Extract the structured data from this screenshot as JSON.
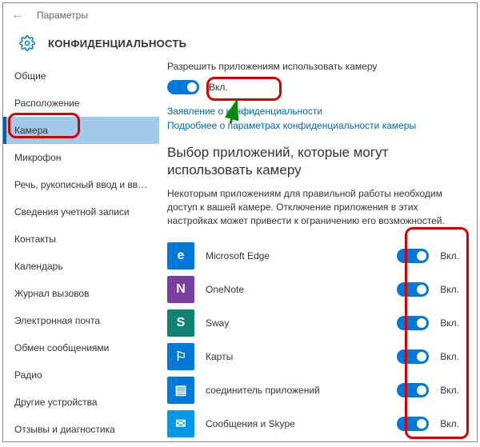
{
  "titlebar": {
    "label": "Параметры"
  },
  "header": {
    "title": "КОНФИДЕНЦИАЛЬНОСТЬ"
  },
  "sidebar": {
    "items": [
      {
        "label": "Общие"
      },
      {
        "label": "Расположение"
      },
      {
        "label": "Камера"
      },
      {
        "label": "Микрофон"
      },
      {
        "label": "Речь, рукописный ввод и ввод текста"
      },
      {
        "label": "Сведения учетной записи"
      },
      {
        "label": "Контакты"
      },
      {
        "label": "Календарь"
      },
      {
        "label": "Журнал вызовов"
      },
      {
        "label": "Электронная почта"
      },
      {
        "label": "Обмен сообщениями"
      },
      {
        "label": "Радио"
      },
      {
        "label": "Другие устройства"
      },
      {
        "label": "Отзывы и диагностика"
      }
    ]
  },
  "content": {
    "permission_title": "Разрешить приложениям использовать камеру",
    "master_toggle_label": "Вкл.",
    "link1": "Заявление о конфиденциальности",
    "link2": "Подробнее о параметрах конфиденциальности камеры",
    "subheading": "Выбор приложений, которые могут использовать камеру",
    "desc": "Некоторым приложениям для правильной работы необходим доступ к вашей камере. Отключение приложения в этих настройках может привести к ограничению его возможностей.",
    "apps": [
      {
        "name": "Microsoft Edge",
        "icon": "e",
        "color": "#0078d7",
        "state": "Вкл."
      },
      {
        "name": "OneNote",
        "icon": "N",
        "color": "#7b3fa0",
        "state": "Вкл."
      },
      {
        "name": "Sway",
        "icon": "S",
        "color": "#108272",
        "state": "Вкл."
      },
      {
        "name": "Карты",
        "icon": "⚐",
        "color": "#0078d7",
        "state": "Вкл."
      },
      {
        "name": "соединитель приложений",
        "icon": "▤",
        "color": "#0078d7",
        "state": "Вкл."
      },
      {
        "name": "Сообщения и Skype",
        "icon": "✉",
        "color": "#0099e5",
        "state": "Вкл."
      }
    ]
  }
}
